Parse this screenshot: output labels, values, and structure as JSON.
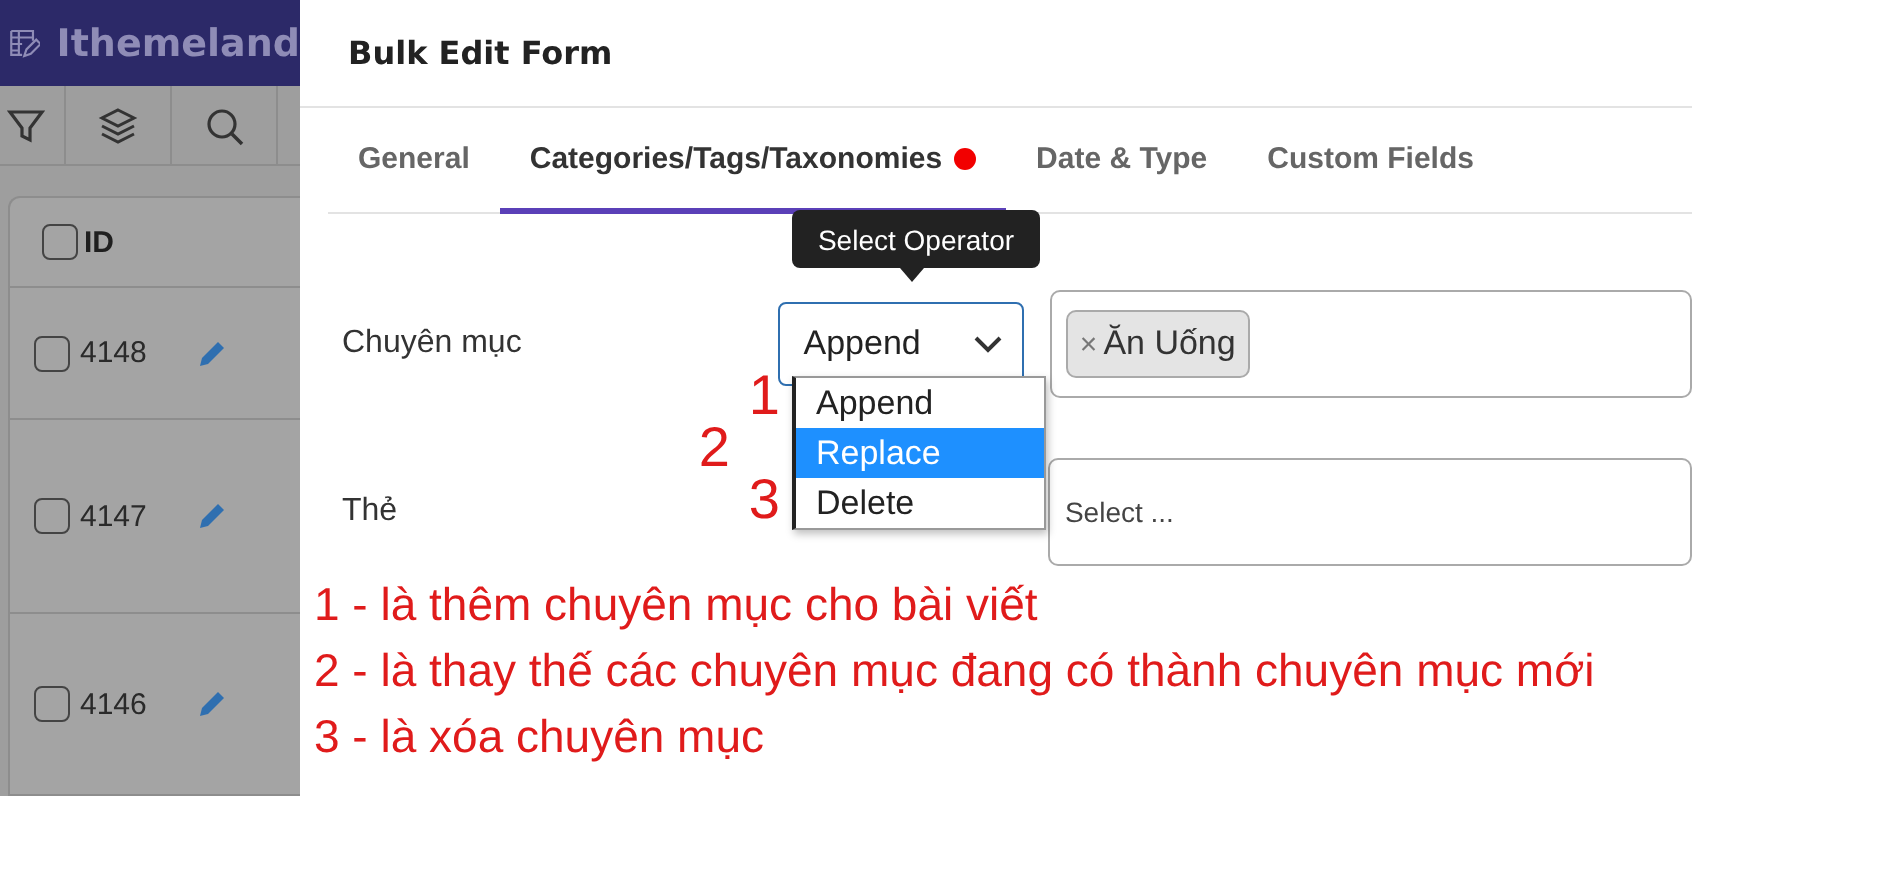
{
  "app": {
    "brand": "Ithemeland",
    "table": {
      "header": {
        "label": "ID",
        "checked": false
      },
      "rows": [
        {
          "id": "4148",
          "checked": false
        },
        {
          "id": "4147",
          "checked": false
        },
        {
          "id": "4146",
          "checked": false
        }
      ]
    }
  },
  "modal": {
    "title": "Bulk Edit Form",
    "tabs": [
      {
        "label": "General",
        "selected": false,
        "dot": false
      },
      {
        "label": "Categories/Tags/Taxonomies",
        "selected": true,
        "dot": true
      },
      {
        "label": "Date & Type",
        "selected": false,
        "dot": false
      },
      {
        "label": "Custom Fields",
        "selected": false,
        "dot": false
      }
    ],
    "tooltip": "Select Operator",
    "fields": [
      {
        "label": "Chuyên mục",
        "operator": "Append",
        "tags": [
          {
            "remove": "×",
            "label": "Ăn Uống"
          }
        ]
      },
      {
        "label": "Thẻ",
        "placeholder": "Select ..."
      }
    ],
    "dropdown": [
      {
        "label": "Append",
        "selected": false
      },
      {
        "label": "Replace",
        "selected": true
      },
      {
        "label": "Delete",
        "selected": false
      }
    ]
  },
  "annotations": {
    "markers": [
      "1",
      "2",
      "3"
    ],
    "notes": [
      "1 - là thêm chuyên mục cho bài viết",
      "2 - là thay thế các chuyên mục đang có thành chuyên mục mới",
      "3 - là xóa chuyên mục"
    ]
  }
}
